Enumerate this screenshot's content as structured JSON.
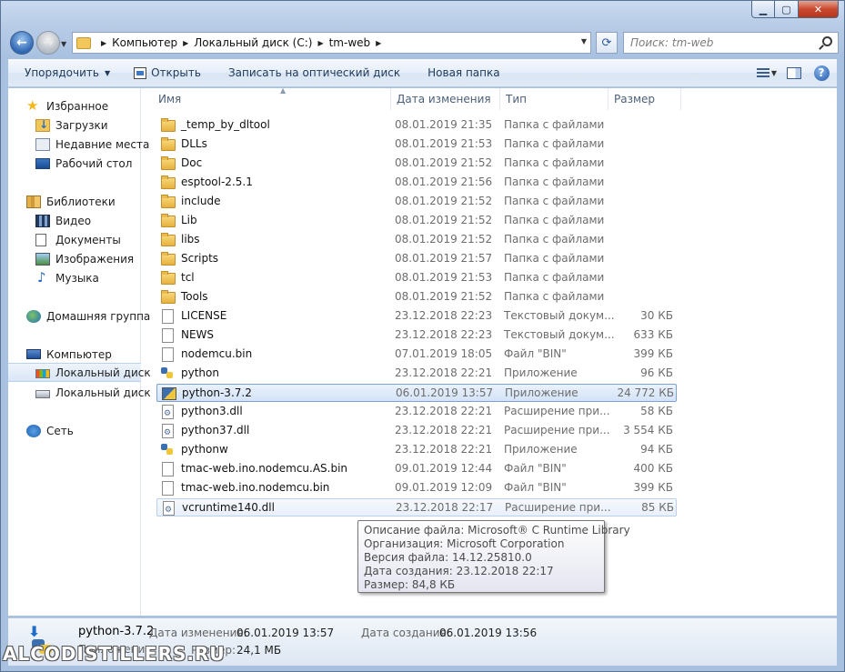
{
  "address": {
    "crumbs": [
      "Компьютер",
      "Локальный диск (C:)",
      "tm-web"
    ]
  },
  "search": {
    "placeholder": "Поиск: tm-web"
  },
  "toolbar": {
    "organize": "Упорядочить",
    "open": "Открыть",
    "burn": "Записать на оптический диск",
    "new_folder": "Новая папка"
  },
  "nav": {
    "favorites": "Избранное",
    "downloads": "Загрузки",
    "recent": "Недавние места",
    "desktop": "Рабочий стол",
    "libraries": "Библиотеки",
    "video": "Видео",
    "documents": "Документы",
    "pictures": "Изображения",
    "music": "Музыка",
    "homegroup": "Домашняя группа",
    "computer": "Компьютер",
    "drive1": "Локальный диск",
    "drive2": "Локальный диск",
    "network": "Сеть"
  },
  "columns": {
    "name": "Имя",
    "date": "Дата изменения",
    "type": "Тип",
    "size": "Размер"
  },
  "files": [
    {
      "name": "_temp_by_dltool",
      "date": "08.01.2019 21:35",
      "type": "Папка с файлами",
      "size": "",
      "icon": "folder-icon"
    },
    {
      "name": "DLLs",
      "date": "08.01.2019 21:53",
      "type": "Папка с файлами",
      "size": "",
      "icon": "folder-icon"
    },
    {
      "name": "Doc",
      "date": "08.01.2019 21:52",
      "type": "Папка с файлами",
      "size": "",
      "icon": "folder-icon"
    },
    {
      "name": "esptool-2.5.1",
      "date": "08.01.2019 21:56",
      "type": "Папка с файлами",
      "size": "",
      "icon": "folder-icon"
    },
    {
      "name": "include",
      "date": "08.01.2019 21:52",
      "type": "Папка с файлами",
      "size": "",
      "icon": "folder-icon"
    },
    {
      "name": "Lib",
      "date": "08.01.2019 21:52",
      "type": "Папка с файлами",
      "size": "",
      "icon": "folder-icon"
    },
    {
      "name": "libs",
      "date": "08.01.2019 21:52",
      "type": "Папка с файлами",
      "size": "",
      "icon": "folder-icon"
    },
    {
      "name": "Scripts",
      "date": "08.01.2019 21:57",
      "type": "Папка с файлами",
      "size": "",
      "icon": "folder-icon"
    },
    {
      "name": "tcl",
      "date": "08.01.2019 21:53",
      "type": "Папка с файлами",
      "size": "",
      "icon": "folder-icon"
    },
    {
      "name": "Tools",
      "date": "08.01.2019 21:52",
      "type": "Папка с файлами",
      "size": "",
      "icon": "folder-icon"
    },
    {
      "name": "LICENSE",
      "date": "23.12.2018 22:23",
      "type": "Текстовый докум...",
      "size": "30 КБ",
      "icon": "document-icon"
    },
    {
      "name": "NEWS",
      "date": "23.12.2018 22:23",
      "type": "Текстовый докум...",
      "size": "633 КБ",
      "icon": "document-icon"
    },
    {
      "name": "nodemcu.bin",
      "date": "07.01.2019 18:05",
      "type": "Файл \"BIN\"",
      "size": "399 КБ",
      "icon": "document-icon"
    },
    {
      "name": "python",
      "date": "23.12.2018 22:21",
      "type": "Приложение",
      "size": "96 КБ",
      "icon": "python-icon"
    },
    {
      "name": "python-3.7.2",
      "date": "06.01.2019 13:57",
      "type": "Приложение",
      "size": "24 772 КБ",
      "icon": "installer-icon"
    },
    {
      "name": "python3.dll",
      "date": "23.12.2018 22:21",
      "type": "Расширение при...",
      "size": "58 КБ",
      "icon": "dll-icon"
    },
    {
      "name": "python37.dll",
      "date": "23.12.2018 22:21",
      "type": "Расширение при...",
      "size": "3 554 КБ",
      "icon": "dll-icon"
    },
    {
      "name": "pythonw",
      "date": "23.12.2018 22:21",
      "type": "Приложение",
      "size": "94 КБ",
      "icon": "python-icon"
    },
    {
      "name": "tmac-web.ino.nodemcu.AS.bin",
      "date": "09.01.2019 12:44",
      "type": "Файл \"BIN\"",
      "size": "400 КБ",
      "icon": "document-icon"
    },
    {
      "name": "tmac-web.ino.nodemcu.bin",
      "date": "09.01.2019 12:09",
      "type": "Файл \"BIN\"",
      "size": "399 КБ",
      "icon": "document-icon"
    },
    {
      "name": "vcruntime140.dll",
      "date": "23.12.2018 22:17",
      "type": "Расширение при...",
      "size": "85 КБ",
      "icon": "dll-icon"
    }
  ],
  "tooltip": [
    "Описание файла: Microsoft® C Runtime Library",
    "Организация: Microsoft Corporation",
    "Версия файла: 14.12.25810.0",
    "Дата создания: 23.12.2018 22:17",
    "Размер: 84,8 КБ"
  ],
  "details": {
    "name": "python-3.7.2",
    "modified_label": "Дата изменения:",
    "modified_value": "06.01.2019 13:57",
    "created_label": "Дата создания:",
    "created_value": "06.01.2019 13:56",
    "type_label": "Приложение",
    "size_label": "Размер:",
    "size_value": "24,1 МБ"
  },
  "watermark": "ALCODISTILLERS.RU"
}
